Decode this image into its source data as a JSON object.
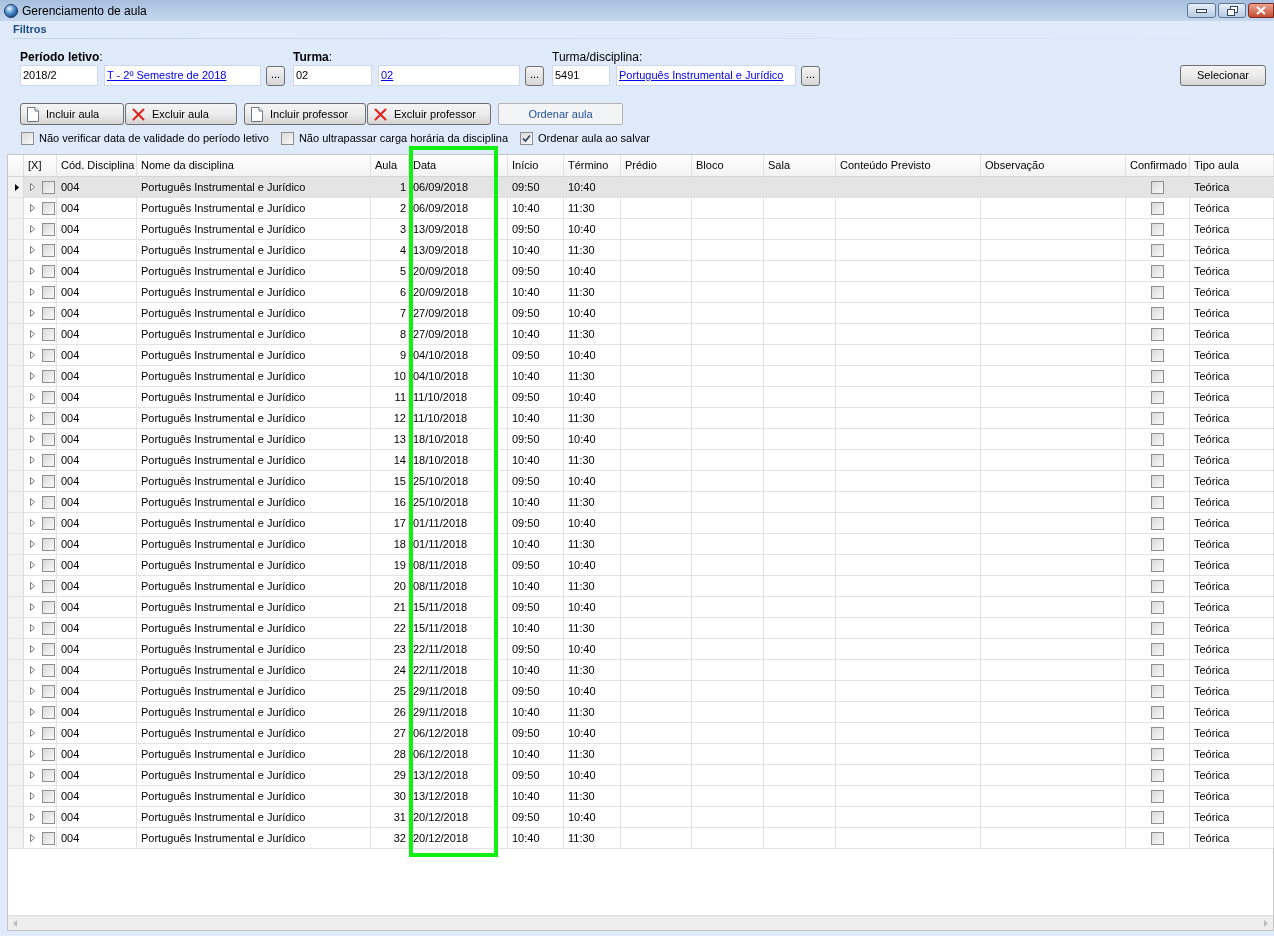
{
  "window": {
    "title": "Gerenciamento de aula"
  },
  "filters": {
    "title": "Filtros",
    "groups": [
      {
        "label": "**Período letivo**:",
        "code": "2018/2",
        "link": "T - 2º Semestre de 2018",
        "lookup": "..."
      },
      {
        "label": "**Turma**:",
        "code": "02",
        "link": "02",
        "lookup": "..."
      },
      {
        "label": "Turma/disciplina:",
        "code": "5491",
        "link": "Português Instrumental e Jurídico",
        "lookup": "..."
      }
    ],
    "submit": "Selecionar"
  },
  "toolbar": [
    [
      {
        "label": "Incluir aula",
        "kind": "add"
      },
      {
        "label": "Excluir aula",
        "kind": "remove"
      }
    ],
    [
      {
        "label": "Incluir professor",
        "kind": "add"
      },
      {
        "label": "Excluir professor",
        "kind": "remove"
      }
    ],
    [
      {
        "label": "Ordenar aula",
        "kind": "flat"
      }
    ]
  ],
  "options": [
    {
      "label": "Não verificar data de validade do período letivo",
      "checked": false
    },
    {
      "label": "Não ultrapassar carga horária da disciplina",
      "checked": false
    },
    {
      "label": "Ordenar aula ao salvar",
      "checked": true
    }
  ],
  "table": {
    "columns": [
      {
        "label": "[X]",
        "kind": "select",
        "highlighted": false
      },
      {
        "label": "Cód. Disciplina",
        "kind": "text",
        "highlighted": false
      },
      {
        "label": "Nome da disciplina",
        "kind": "text",
        "highlighted": false
      },
      {
        "label": "Aula",
        "kind": "number",
        "highlighted": false
      },
      {
        "label": "Data",
        "kind": "text",
        "highlighted": true
      },
      {
        "label": "Início",
        "kind": "text",
        "highlighted": false
      },
      {
        "label": "Término",
        "kind": "text",
        "highlighted": false
      },
      {
        "label": "Prédio",
        "kind": "text",
        "highlighted": false
      },
      {
        "label": "Bloco",
        "kind": "text",
        "highlighted": false
      },
      {
        "label": "Sala",
        "kind": "text",
        "highlighted": false
      },
      {
        "label": "Conteúdo Previsto",
        "kind": "text",
        "highlighted": false
      },
      {
        "label": "Observação",
        "kind": "text",
        "highlighted": false
      },
      {
        "label": "Confirmado",
        "kind": "check",
        "highlighted": false
      },
      {
        "label": "Tipo aula",
        "kind": "text",
        "highlighted": false
      }
    ],
    "rows": [
      {
        "selected": true,
        "expanded": false,
        "cells": [
          false,
          "004",
          "Português Instrumental e Jurídico",
          "1",
          "06/09/2018",
          "09:50",
          "10:40",
          null,
          null,
          null,
          null,
          null,
          false,
          "Teórica"
        ]
      },
      {
        "selected": false,
        "expanded": false,
        "cells": [
          false,
          "004",
          "Português Instrumental e Jurídico",
          "2",
          "06/09/2018",
          "10:40",
          "11:30",
          null,
          null,
          null,
          null,
          null,
          false,
          "Teórica"
        ]
      },
      {
        "selected": false,
        "expanded": false,
        "cells": [
          false,
          "004",
          "Português Instrumental e Jurídico",
          "3",
          "13/09/2018",
          "09:50",
          "10:40",
          null,
          null,
          null,
          null,
          null,
          false,
          "Teórica"
        ]
      },
      {
        "selected": false,
        "expanded": false,
        "cells": [
          false,
          "004",
          "Português Instrumental e Jurídico",
          "4",
          "13/09/2018",
          "10:40",
          "11:30",
          null,
          null,
          null,
          null,
          null,
          false,
          "Teórica"
        ]
      },
      {
        "selected": false,
        "expanded": false,
        "cells": [
          false,
          "004",
          "Português Instrumental e Jurídico",
          "5",
          "20/09/2018",
          "09:50",
          "10:40",
          null,
          null,
          null,
          null,
          null,
          false,
          "Teórica"
        ]
      },
      {
        "selected": false,
        "expanded": false,
        "cells": [
          false,
          "004",
          "Português Instrumental e Jurídico",
          "6",
          "20/09/2018",
          "10:40",
          "11:30",
          null,
          null,
          null,
          null,
          null,
          false,
          "Teórica"
        ]
      },
      {
        "selected": false,
        "expanded": false,
        "cells": [
          false,
          "004",
          "Português Instrumental e Jurídico",
          "7",
          "27/09/2018",
          "09:50",
          "10:40",
          null,
          null,
          null,
          null,
          null,
          false,
          "Teórica"
        ]
      },
      {
        "selected": false,
        "expanded": false,
        "cells": [
          false,
          "004",
          "Português Instrumental e Jurídico",
          "8",
          "27/09/2018",
          "10:40",
          "11:30",
          null,
          null,
          null,
          null,
          null,
          false,
          "Teórica"
        ]
      },
      {
        "selected": false,
        "expanded": false,
        "cells": [
          false,
          "004",
          "Português Instrumental e Jurídico",
          "9",
          "04/10/2018",
          "09:50",
          "10:40",
          null,
          null,
          null,
          null,
          null,
          false,
          "Teórica"
        ]
      },
      {
        "selected": false,
        "expanded": false,
        "cells": [
          false,
          "004",
          "Português Instrumental e Jurídico",
          "10",
          "04/10/2018",
          "10:40",
          "11:30",
          null,
          null,
          null,
          null,
          null,
          false,
          "Teórica"
        ]
      },
      {
        "selected": false,
        "expanded": false,
        "cells": [
          false,
          "004",
          "Português Instrumental e Jurídico",
          "11",
          "11/10/2018",
          "09:50",
          "10:40",
          null,
          null,
          null,
          null,
          null,
          false,
          "Teórica"
        ]
      },
      {
        "selected": false,
        "expanded": false,
        "cells": [
          false,
          "004",
          "Português Instrumental e Jurídico",
          "12",
          "11/10/2018",
          "10:40",
          "11:30",
          null,
          null,
          null,
          null,
          null,
          false,
          "Teórica"
        ]
      },
      {
        "selected": false,
        "expanded": false,
        "cells": [
          false,
          "004",
          "Português Instrumental e Jurídico",
          "13",
          "18/10/2018",
          "09:50",
          "10:40",
          null,
          null,
          null,
          null,
          null,
          false,
          "Teórica"
        ]
      },
      {
        "selected": false,
        "expanded": false,
        "cells": [
          false,
          "004",
          "Português Instrumental e Jurídico",
          "14",
          "18/10/2018",
          "10:40",
          "11:30",
          null,
          null,
          null,
          null,
          null,
          false,
          "Teórica"
        ]
      },
      {
        "selected": false,
        "expanded": false,
        "cells": [
          false,
          "004",
          "Português Instrumental e Jurídico",
          "15",
          "25/10/2018",
          "09:50",
          "10:40",
          null,
          null,
          null,
          null,
          null,
          false,
          "Teórica"
        ]
      },
      {
        "selected": false,
        "expanded": false,
        "cells": [
          false,
          "004",
          "Português Instrumental e Jurídico",
          "16",
          "25/10/2018",
          "10:40",
          "11:30",
          null,
          null,
          null,
          null,
          null,
          false,
          "Teórica"
        ]
      },
      {
        "selected": false,
        "expanded": false,
        "cells": [
          false,
          "004",
          "Português Instrumental e Jurídico",
          "17",
          "01/11/2018",
          "09:50",
          "10:40",
          null,
          null,
          null,
          null,
          null,
          false,
          "Teórica"
        ]
      },
      {
        "selected": false,
        "expanded": false,
        "cells": [
          false,
          "004",
          "Português Instrumental e Jurídico",
          "18",
          "01/11/2018",
          "10:40",
          "11:30",
          null,
          null,
          null,
          null,
          null,
          false,
          "Teórica"
        ]
      },
      {
        "selected": false,
        "expanded": false,
        "cells": [
          false,
          "004",
          "Português Instrumental e Jurídico",
          "19",
          "08/11/2018",
          "09:50",
          "10:40",
          null,
          null,
          null,
          null,
          null,
          false,
          "Teórica"
        ]
      },
      {
        "selected": false,
        "expanded": false,
        "cells": [
          false,
          "004",
          "Português Instrumental e Jurídico",
          "20",
          "08/11/2018",
          "10:40",
          "11:30",
          null,
          null,
          null,
          null,
          null,
          false,
          "Teórica"
        ]
      },
      {
        "selected": false,
        "expanded": false,
        "cells": [
          false,
          "004",
          "Português Instrumental e Jurídico",
          "21",
          "15/11/2018",
          "09:50",
          "10:40",
          null,
          null,
          null,
          null,
          null,
          false,
          "Teórica"
        ]
      },
      {
        "selected": false,
        "expanded": false,
        "cells": [
          false,
          "004",
          "Português Instrumental e Jurídico",
          "22",
          "15/11/2018",
          "10:40",
          "11:30",
          null,
          null,
          null,
          null,
          null,
          false,
          "Teórica"
        ]
      },
      {
        "selected": false,
        "expanded": false,
        "cells": [
          false,
          "004",
          "Português Instrumental e Jurídico",
          "23",
          "22/11/2018",
          "09:50",
          "10:40",
          null,
          null,
          null,
          null,
          null,
          false,
          "Teórica"
        ]
      },
      {
        "selected": false,
        "expanded": false,
        "cells": [
          false,
          "004",
          "Português Instrumental e Jurídico",
          "24",
          "22/11/2018",
          "10:40",
          "11:30",
          null,
          null,
          null,
          null,
          null,
          false,
          "Teórica"
        ]
      },
      {
        "selected": false,
        "expanded": false,
        "cells": [
          false,
          "004",
          "Português Instrumental e Jurídico",
          "25",
          "29/11/2018",
          "09:50",
          "10:40",
          null,
          null,
          null,
          null,
          null,
          false,
          "Teórica"
        ]
      },
      {
        "selected": false,
        "expanded": false,
        "cells": [
          false,
          "004",
          "Português Instrumental e Jurídico",
          "26",
          "29/11/2018",
          "10:40",
          "11:30",
          null,
          null,
          null,
          null,
          null,
          false,
          "Teórica"
        ]
      },
      {
        "selected": false,
        "expanded": false,
        "cells": [
          false,
          "004",
          "Português Instrumental e Jurídico",
          "27",
          "06/12/2018",
          "09:50",
          "10:40",
          null,
          null,
          null,
          null,
          null,
          false,
          "Teórica"
        ]
      },
      {
        "selected": false,
        "expanded": false,
        "cells": [
          false,
          "004",
          "Português Instrumental e Jurídico",
          "28",
          "06/12/2018",
          "10:40",
          "11:30",
          null,
          null,
          null,
          null,
          null,
          false,
          "Teórica"
        ]
      },
      {
        "selected": false,
        "expanded": false,
        "cells": [
          false,
          "004",
          "Português Instrumental e Jurídico",
          "29",
          "13/12/2018",
          "09:50",
          "10:40",
          null,
          null,
          null,
          null,
          null,
          false,
          "Teórica"
        ]
      },
      {
        "selected": false,
        "expanded": false,
        "cells": [
          false,
          "004",
          "Português Instrumental e Jurídico",
          "30",
          "13/12/2018",
          "10:40",
          "11:30",
          null,
          null,
          null,
          null,
          null,
          false,
          "Teórica"
        ]
      },
      {
        "selected": false,
        "expanded": false,
        "cells": [
          false,
          "004",
          "Português Instrumental e Jurídico",
          "31",
          "20/12/2018",
          "09:50",
          "10:40",
          null,
          null,
          null,
          null,
          null,
          false,
          "Teórica"
        ]
      },
      {
        "selected": false,
        "expanded": false,
        "cells": [
          false,
          "004",
          "Português Instrumental e Jurídico",
          "32",
          "20/12/2018",
          "10:40",
          "11:30",
          null,
          null,
          null,
          null,
          null,
          false,
          "Teórica"
        ]
      }
    ]
  }
}
